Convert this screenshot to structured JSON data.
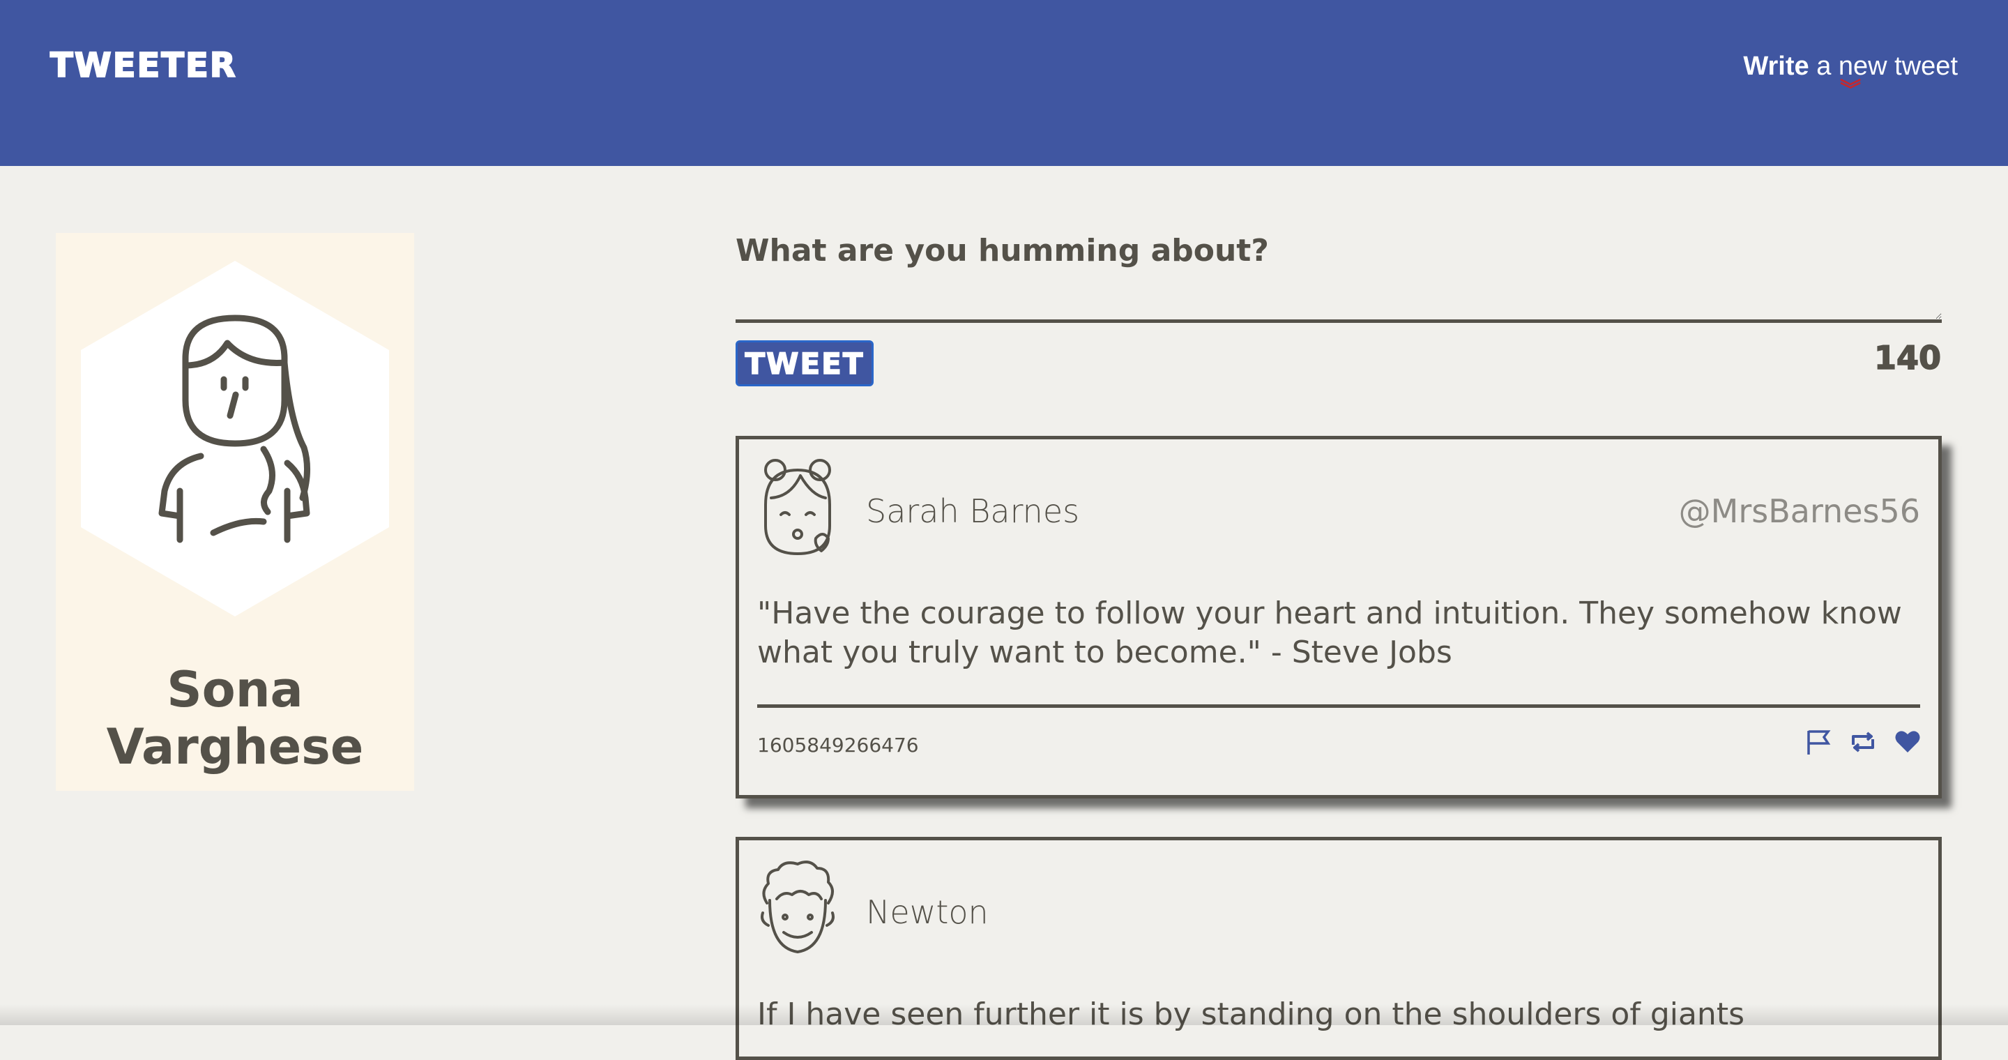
{
  "nav": {
    "brand": "TWEETER",
    "compose_toggle_bold": "Write",
    "compose_toggle_rest": " a new tweet",
    "compose_toggle_icon": "double-chevron-down-icon"
  },
  "profile": {
    "name": "Sona Varghese",
    "avatar_icon": "woman-avatar-icon"
  },
  "composer": {
    "label": "What are you humming about?",
    "value": "",
    "button_label": "TWEET",
    "char_count": "140"
  },
  "tweets": [
    {
      "name": "Sarah Barnes",
      "handle": "@MrsBarnes56",
      "body": "\"Have the courage to follow your heart and intuition. They somehow know what you truly want to become.\" - Steve Jobs",
      "timestamp": "1605849266476",
      "avatar_icon": "girl-kiss-avatar-icon",
      "actions": [
        "flag-icon",
        "retweet-icon",
        "heart-icon"
      ]
    },
    {
      "name": "Newton",
      "handle": "",
      "body": "If I have seen further it is by standing on the shoulders of giants",
      "avatar_icon": "curly-hair-man-avatar-icon"
    }
  ],
  "colors": {
    "nav_bg": "#4056a1",
    "page_bg": "#f1f0ec",
    "profile_bg": "#fcf5e8",
    "text": "#545149",
    "accent_red": "#c3282f"
  }
}
